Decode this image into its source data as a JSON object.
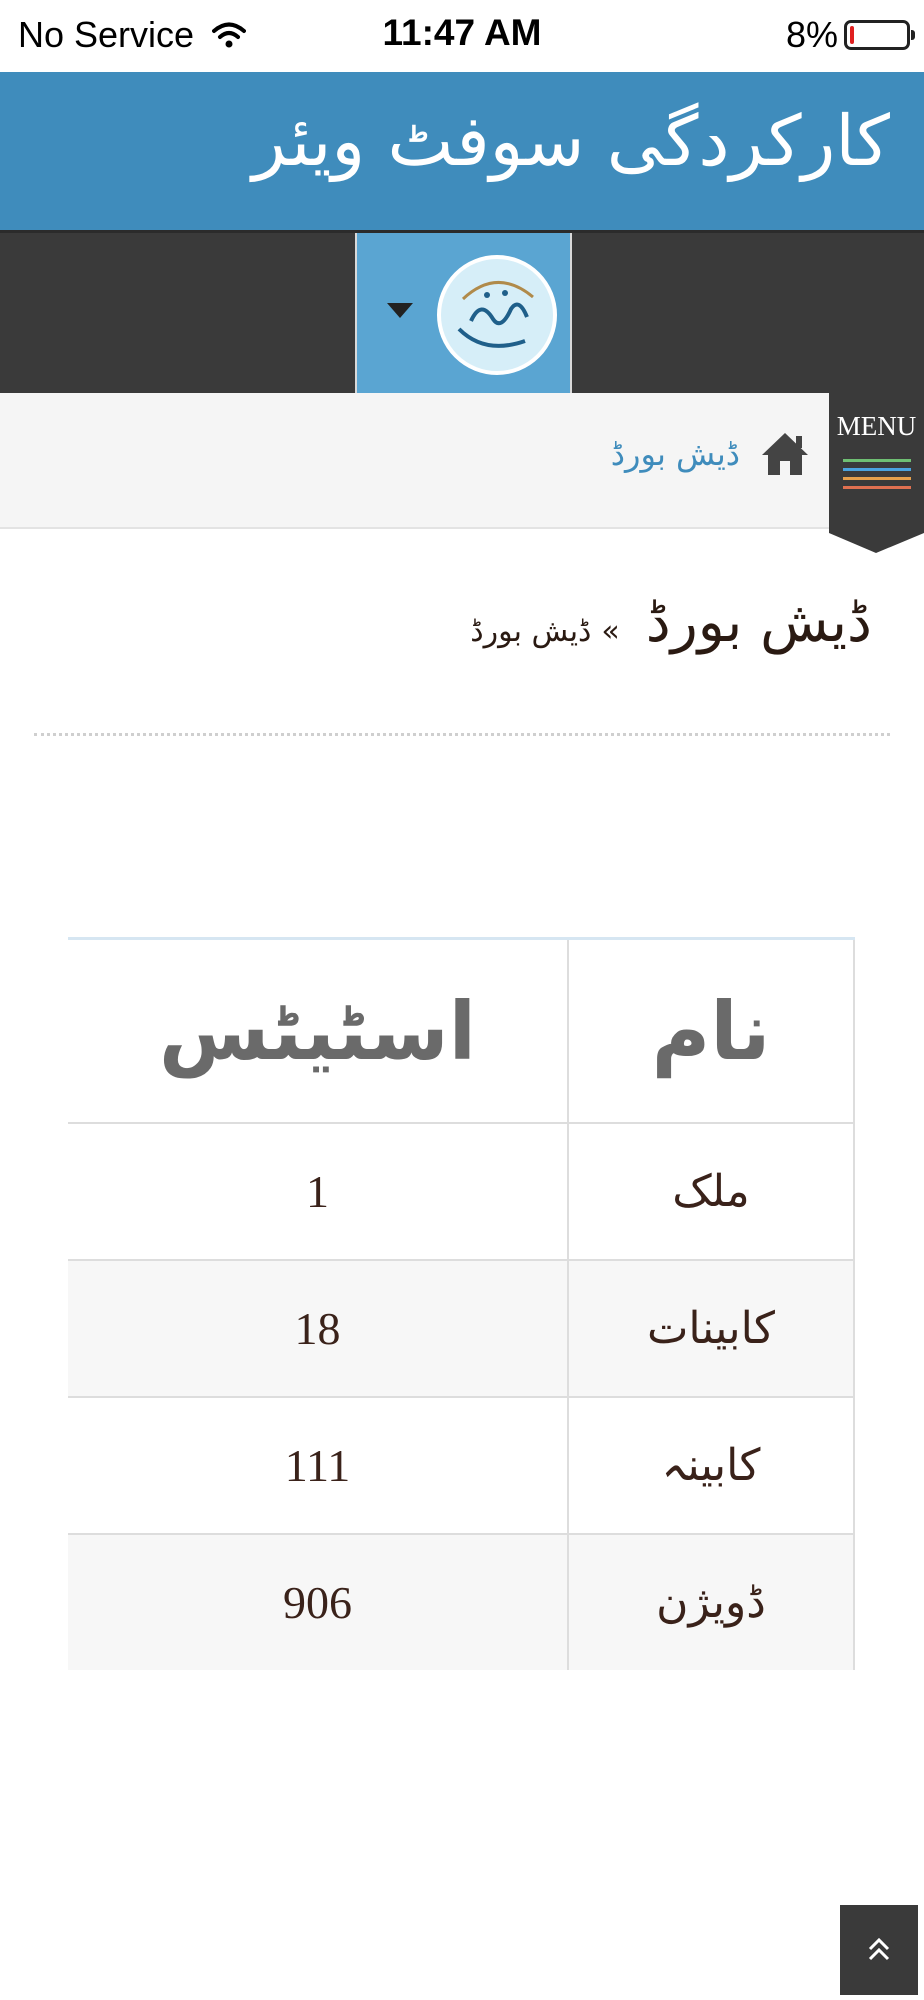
{
  "status_bar": {
    "carrier": "No Service",
    "time": "11:47 AM",
    "battery_percent": "8%",
    "battery_level": 0.08
  },
  "header": {
    "title": "کارکردگی سوفٹ ویئر"
  },
  "breadcrumb": {
    "home_icon": "home-icon",
    "link_label": "ڈیش بورڈ"
  },
  "menu": {
    "label": "MENU",
    "line_colors": [
      "#6fbf73",
      "#4aa3df",
      "#e5a04c",
      "#e07050"
    ]
  },
  "page": {
    "title": "ڈیش بورڈ",
    "separator": "»",
    "crumb": "ڈیش بورڈ"
  },
  "table": {
    "headers": {
      "name": "نام",
      "status": "اسٹیٹس"
    },
    "rows": [
      {
        "name": "ملک",
        "value": "1"
      },
      {
        "name": "کابینات",
        "value": "18"
      },
      {
        "name": "کابینہ",
        "value": "111"
      },
      {
        "name": "ڈویژن",
        "value": "906"
      }
    ]
  },
  "colors": {
    "header_blue": "#3f8cbc",
    "logo_box_blue": "#5aa5d2",
    "dark_bar": "#3a3a3a"
  }
}
